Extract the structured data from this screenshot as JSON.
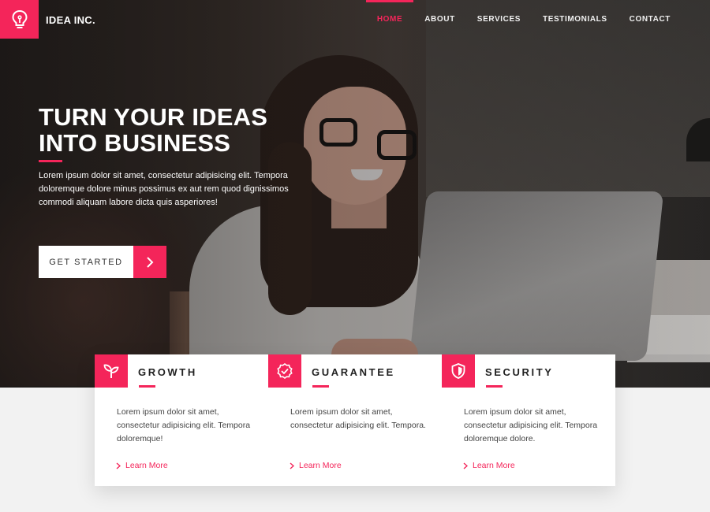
{
  "brand": {
    "name": "IDEA INC.",
    "icon": "lightbulb-icon"
  },
  "nav": {
    "items": [
      {
        "label": "HOME",
        "active": true
      },
      {
        "label": "ABOUT",
        "active": false
      },
      {
        "label": "SERVICES",
        "active": false
      },
      {
        "label": "TESTIMONIALS",
        "active": false
      },
      {
        "label": "CONTACT",
        "active": false
      }
    ]
  },
  "hero": {
    "title_line1": "TURN YOUR IDEAS",
    "title_line2": "INTO BUSINESS",
    "description": "Lorem ipsum dolor sit amet, consectetur adipisicing elit. Tempora doloremque dolore minus possimus ex aut rem quod dignissimos commodi aliquam labore dicta quis asperiores!",
    "cta_label": "GET STARTED",
    "cta_icon": "chevron-right-icon"
  },
  "features": [
    {
      "title": "GROWTH",
      "icon": "sprout-icon",
      "description": "Lorem ipsum dolor sit amet, consectetur adipisicing elit. Tempora doloremque!",
      "link": "Learn More"
    },
    {
      "title": "GUARANTEE",
      "icon": "badge-check-icon",
      "description": "Lorem ipsum dolor sit amet, consectetur adipisicing elit. Tempora.",
      "link": "Learn More"
    },
    {
      "title": "SECURITY",
      "icon": "shield-icon",
      "description": "Lorem ipsum dolor sit amet, consectetur adipisicing elit. Tempora doloremque dolore.",
      "link": "Learn More"
    }
  ],
  "colors": {
    "accent": "#f4255a",
    "background": "#f2f2f2",
    "card": "#ffffff"
  }
}
